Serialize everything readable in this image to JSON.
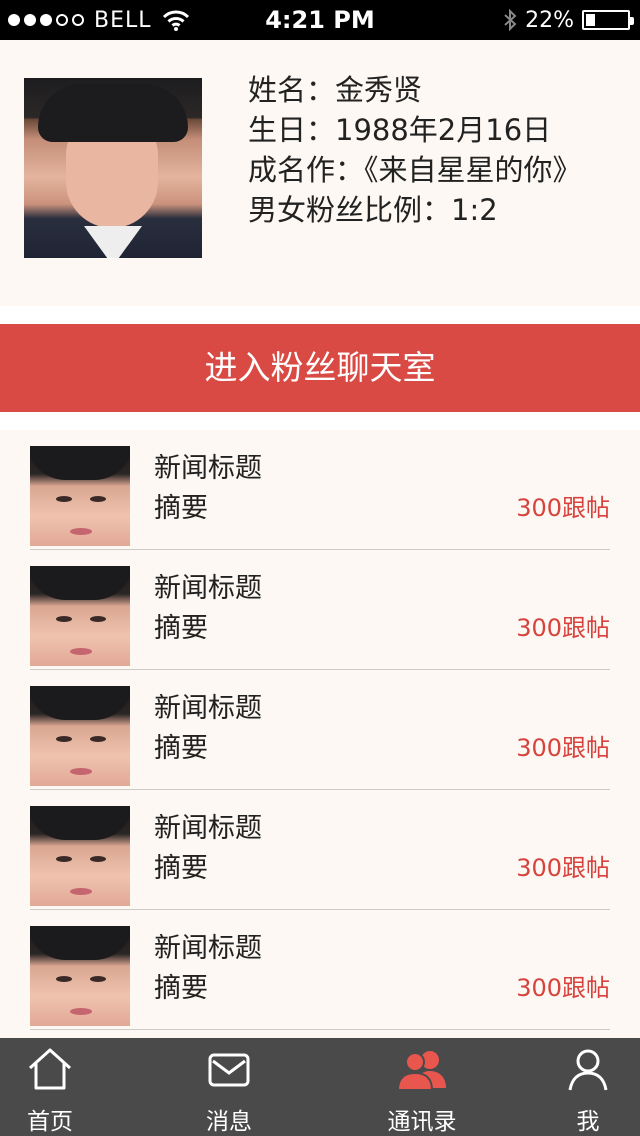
{
  "status_bar": {
    "carrier": "BELL",
    "time": "4:21 PM",
    "battery": "22%",
    "battery_level": 0.22,
    "signal_bars_filled": 3,
    "signal_bars_total": 5
  },
  "profile": {
    "name_line": "姓名：金秀贤",
    "birthday_line": "生日：1988年2月16日",
    "famous_work_line": "成名作：《来自星星的你》",
    "fan_ratio_line": "男女粉丝比例：1:2"
  },
  "chat_button": {
    "label": "进入粉丝聊天室"
  },
  "news": [
    {
      "title": "新闻标题",
      "summary": "摘要",
      "replies": "300跟帖"
    },
    {
      "title": "新闻标题",
      "summary": "摘要",
      "replies": "300跟帖"
    },
    {
      "title": "新闻标题",
      "summary": "摘要",
      "replies": "300跟帖"
    },
    {
      "title": "新闻标题",
      "summary": "摘要",
      "replies": "300跟帖"
    },
    {
      "title": "新闻标题",
      "summary": "摘要",
      "replies": "300跟帖"
    }
  ],
  "tabbar": {
    "tabs": [
      {
        "label": "首页",
        "icon": "home-icon"
      },
      {
        "label": "消息",
        "icon": "mail-icon"
      },
      {
        "label": "通讯录",
        "icon": "contacts-icon"
      },
      {
        "label": "我",
        "icon": "user-icon"
      }
    ],
    "active_index": 2
  },
  "colors": {
    "accent_red": "#d84a43",
    "reply_red": "#d8423c",
    "tab_bg": "#4a4a4a",
    "active_icon": "#e8564e"
  }
}
